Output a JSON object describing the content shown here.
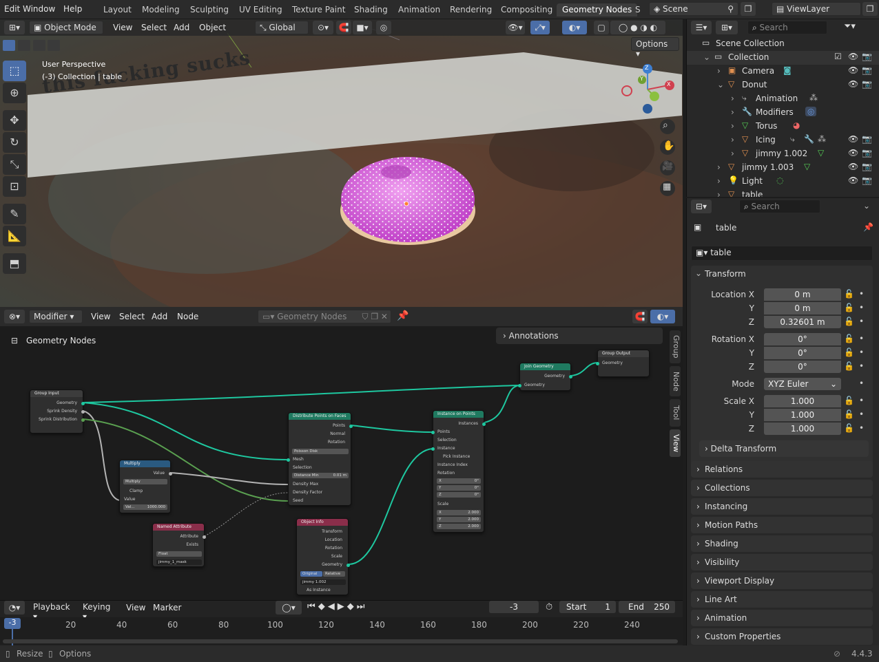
{
  "menu": {
    "window": "Window",
    "help": "Help",
    "edit": "Edit"
  },
  "workspaces": [
    "Layout",
    "Modeling",
    "Sculpting",
    "UV Editing",
    "Texture Paint",
    "Shading",
    "Animation",
    "Rendering",
    "Compositing",
    "Geometry Nodes",
    "S"
  ],
  "active_workspace": "Geometry Nodes",
  "scene": {
    "label": "Scene",
    "view_layer": "ViewLayer"
  },
  "viewport": {
    "mode": "Object Mode",
    "menus": [
      "View",
      "Select",
      "Add",
      "Object"
    ],
    "orientation": "Global",
    "options": "Options",
    "overlay_title": "User Perspective",
    "overlay_subtitle": "(-3) Collection | table",
    "banner_text": "this fucking sucks",
    "gizmo": {
      "x": "X",
      "y": "Y",
      "z": "Z"
    }
  },
  "node_editor": {
    "type": "Modifier",
    "menus": [
      "View",
      "Select",
      "Add",
      "Node"
    ],
    "tree_name": "Geometry Nodes",
    "breadcrumb": "Geometry Nodes",
    "annotations": "Annotations",
    "side_tabs": [
      "Group",
      "Node",
      "Tool",
      "View"
    ],
    "nodes": {
      "group_input": {
        "title": "Group Input",
        "outputs": [
          "Geometry",
          "Sprink Density",
          "Sprink Distribution"
        ]
      },
      "multiply": {
        "title": "Multiply",
        "value": "Value",
        "op": "Multiply",
        "clamp": "Clamp",
        "in_value": "Value",
        "field": "Val...",
        "field_val": "1000.000"
      },
      "named_attribute": {
        "title": "Named Attribute",
        "attribute": "Attribute",
        "exists": "Exists",
        "type": "Float",
        "name": "jimmy_1_mask"
      },
      "distribute": {
        "title": "Distribute Points on Faces",
        "points": "Points",
        "normal": "Normal",
        "rotation": "Rotation",
        "method": "Poisson Disk",
        "mesh": "Mesh",
        "selection": "Selection",
        "dist_min": "Distance Min",
        "dist_min_val": "0.01 m",
        "density_max": "Density Max",
        "density_factor": "Density Factor",
        "seed": "Seed"
      },
      "object_info": {
        "title": "Object Info",
        "transform": "Transform",
        "location": "Location",
        "rotation": "Rotation",
        "scale": "Scale",
        "geometry": "Geometry",
        "original": "Original",
        "relative": "Relative",
        "object": "jimmy 1.002",
        "as_instance": "As Instance"
      },
      "instance_on_points": {
        "title": "Instance on Points",
        "instances": "Instances",
        "points": "Points",
        "selection": "Selection",
        "instance": "Instance",
        "pick": "Pick Instance",
        "index": "Instance Index",
        "rotation": "Rotation",
        "rx": "X",
        "rxv": "0°",
        "ry": "Y",
        "ryv": "0°",
        "rz": "Z",
        "rzv": "0°",
        "scale": "Scale",
        "sx": "X",
        "sxv": "2.000",
        "sy": "Y",
        "syv": "2.000",
        "sz": "Z",
        "szv": "2.000"
      },
      "join": {
        "title": "Join Geometry",
        "out": "Geometry",
        "in": "Geometry"
      },
      "group_output": {
        "title": "Group Output",
        "in": "Geometry"
      }
    }
  },
  "timeline": {
    "menus": [
      "Playback",
      "Keying",
      "View",
      "Marker"
    ],
    "current_frame": "-3",
    "start_label": "Start",
    "start": "1",
    "end_label": "End",
    "end": "250",
    "ticks": [
      "20",
      "40",
      "60",
      "80",
      "100",
      "120",
      "140",
      "160",
      "180",
      "200",
      "220",
      "240"
    ],
    "playhead": "-3"
  },
  "status": {
    "resize": "Resize",
    "options": "Options",
    "version": "4.4.3"
  },
  "outliner": {
    "search": "Search",
    "rows": [
      {
        "label": "Scene Collection",
        "indent": 0
      },
      {
        "label": "Collection",
        "indent": 1
      },
      {
        "label": "Camera",
        "indent": 2
      },
      {
        "label": "Donut",
        "indent": 2
      },
      {
        "label": "Animation",
        "indent": 3
      },
      {
        "label": "Modifiers",
        "indent": 3
      },
      {
        "label": "Torus",
        "indent": 3
      },
      {
        "label": "Icing",
        "indent": 3
      },
      {
        "label": "jimmy 1.002",
        "indent": 3
      },
      {
        "label": "jimmy 1.003",
        "indent": 2
      },
      {
        "label": "Light",
        "indent": 2
      },
      {
        "label": "table",
        "indent": 2
      }
    ]
  },
  "properties": {
    "search": "Search",
    "object_name": "table",
    "data_name": "table",
    "transform": "Transform",
    "location_x_label": "Location X",
    "location_x": "0 m",
    "location_y_label": "Y",
    "location_y": "0 m",
    "location_z_label": "Z",
    "location_z": "0.32601 m",
    "rotation_x_label": "Rotation X",
    "rotation_x": "0°",
    "rotation_y_label": "Y",
    "rotation_y": "0°",
    "rotation_z_label": "Z",
    "rotation_z": "0°",
    "mode_label": "Mode",
    "mode": "XYZ Euler",
    "scale_x_label": "Scale X",
    "scale_x": "1.000",
    "scale_y_label": "Y",
    "scale_y": "1.000",
    "scale_z_label": "Z",
    "scale_z": "1.000",
    "delta": "Delta Transform",
    "panels": [
      "Relations",
      "Collections",
      "Instancing",
      "Motion Paths",
      "Shading",
      "Visibility",
      "Viewport Display",
      "Line Art",
      "Animation",
      "Custom Properties"
    ]
  }
}
